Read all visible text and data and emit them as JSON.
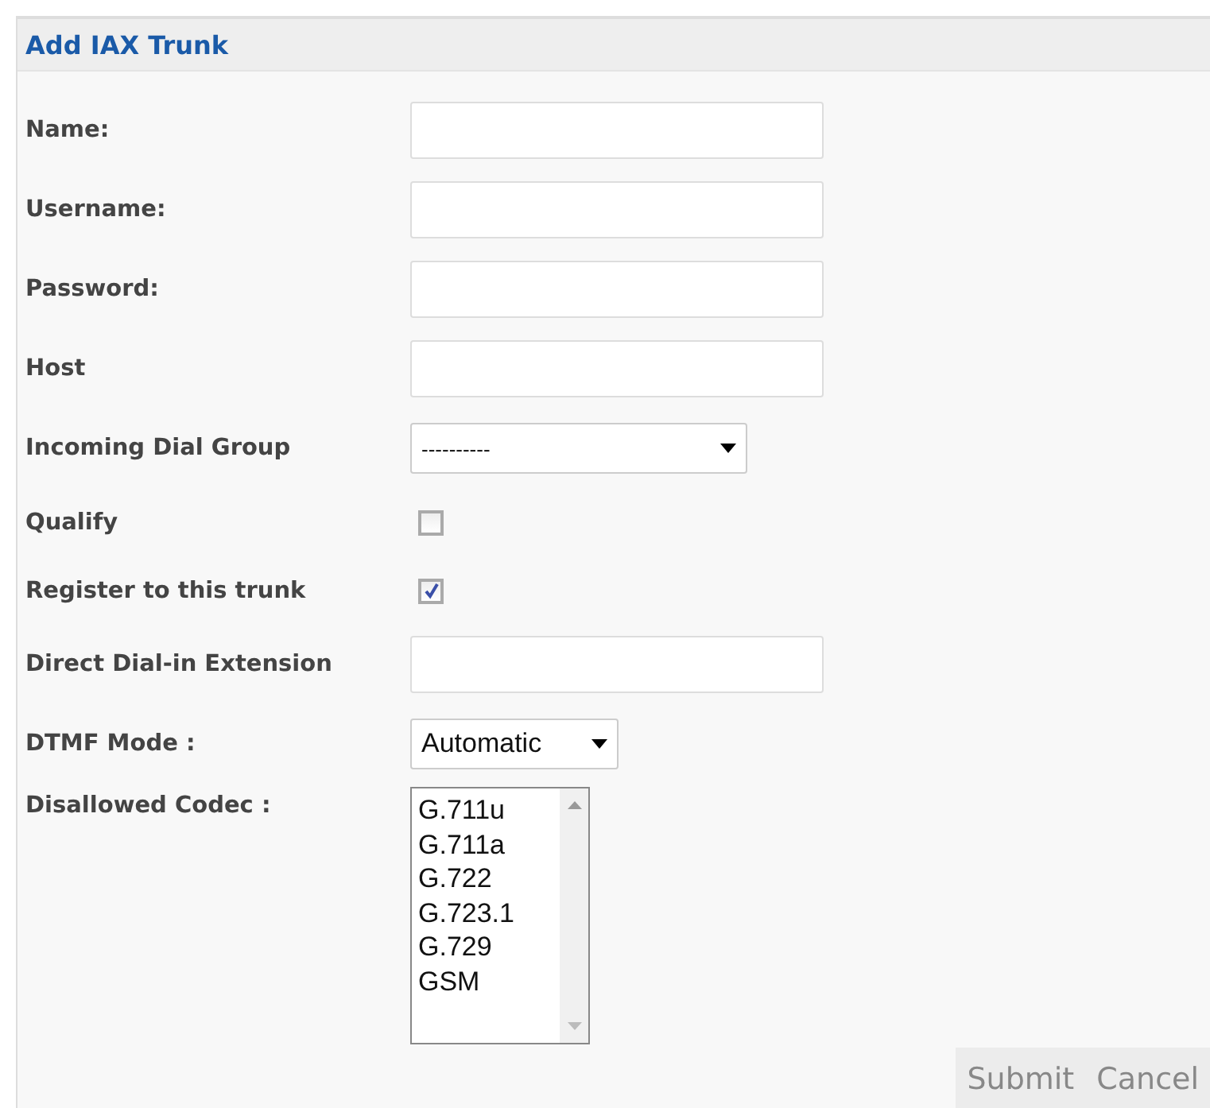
{
  "panel": {
    "title": "Add IAX Trunk"
  },
  "fields": [
    {
      "label": "Name:",
      "kind": "text"
    },
    {
      "label": "Username:",
      "kind": "text"
    },
    {
      "label": "Password:",
      "kind": "text"
    },
    {
      "label": "Host",
      "kind": "text"
    },
    {
      "label": "Incoming Dial Group",
      "kind": "select",
      "value": "----------",
      "wide": true
    },
    {
      "label": "Qualify",
      "kind": "checkbox",
      "checked": false
    },
    {
      "label": "Register to this trunk",
      "kind": "checkbox",
      "checked": true
    },
    {
      "label": "Direct Dial-in Extension",
      "kind": "text"
    },
    {
      "label": "DTMF Mode :",
      "kind": "select",
      "value": "Automatic",
      "wide": false
    },
    {
      "label": "Disallowed Codec :",
      "kind": "listbox",
      "options": [
        "G.711u",
        "G.711a",
        "G.722",
        "G.723.1",
        "G.729",
        "GSM"
      ]
    }
  ],
  "buttons": [
    "Submit",
    "Cancel"
  ]
}
